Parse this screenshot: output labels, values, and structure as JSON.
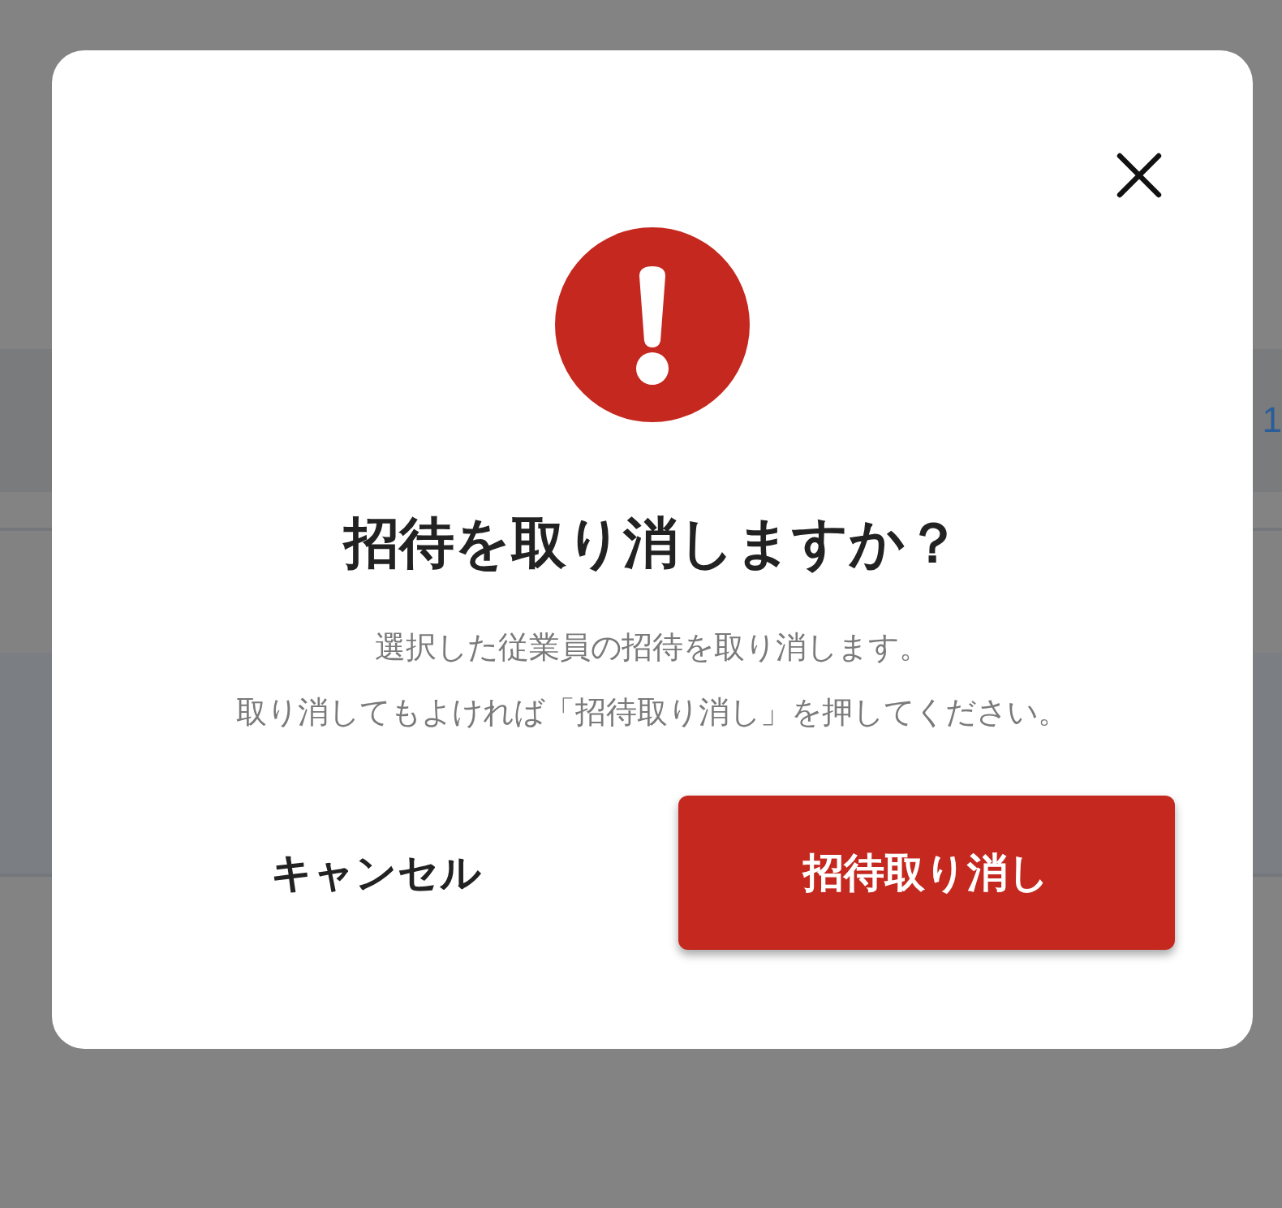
{
  "background": {
    "cell_text": "1"
  },
  "dialog": {
    "title": "招待を取り消しますか？",
    "message_lines": [
      "選択した従業員の招待を取り消します。",
      "取り消してもよければ「招待取り消し」を押してください。"
    ],
    "buttons": [
      {
        "label": "キャンセル",
        "kind": "text"
      },
      {
        "label": "招待取り消し",
        "kind": "danger"
      }
    ]
  }
}
